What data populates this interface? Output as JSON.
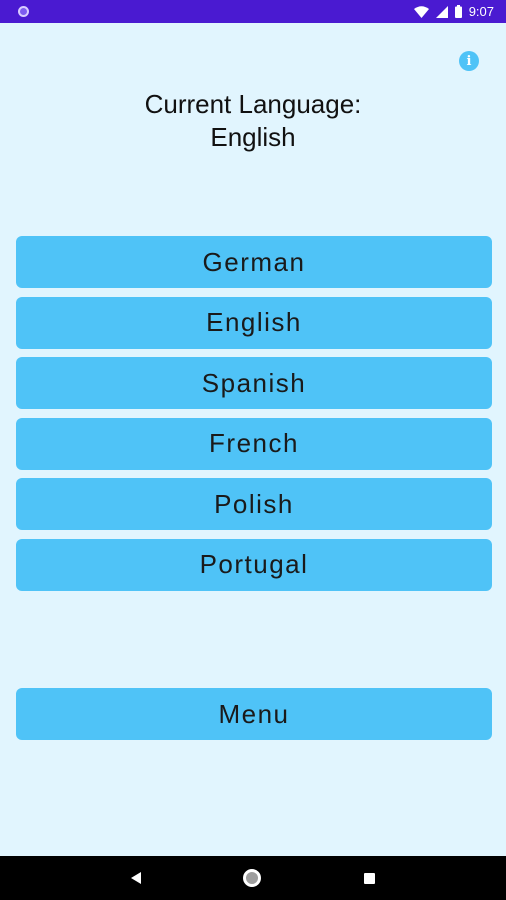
{
  "status_bar": {
    "time": "9:07",
    "icons": [
      "notification-dot-icon",
      "wifi-icon",
      "signal-icon",
      "battery-icon"
    ]
  },
  "header": {
    "line1": "Current Language:",
    "line2": "English"
  },
  "info_icon": {
    "glyph": "i"
  },
  "languages": [
    {
      "label": "German"
    },
    {
      "label": "English"
    },
    {
      "label": "Spanish"
    },
    {
      "label": "French"
    },
    {
      "label": "Polish"
    },
    {
      "label": "Portugal"
    }
  ],
  "menu_button": {
    "label": "Menu"
  },
  "nav_bar": {
    "icons": [
      "back-icon",
      "home-icon",
      "recents-icon"
    ]
  },
  "colors": {
    "status_bar": "#4a1ad1",
    "background": "#e1f5fe",
    "button": "#4fc3f7",
    "nav_bar": "#000000"
  }
}
